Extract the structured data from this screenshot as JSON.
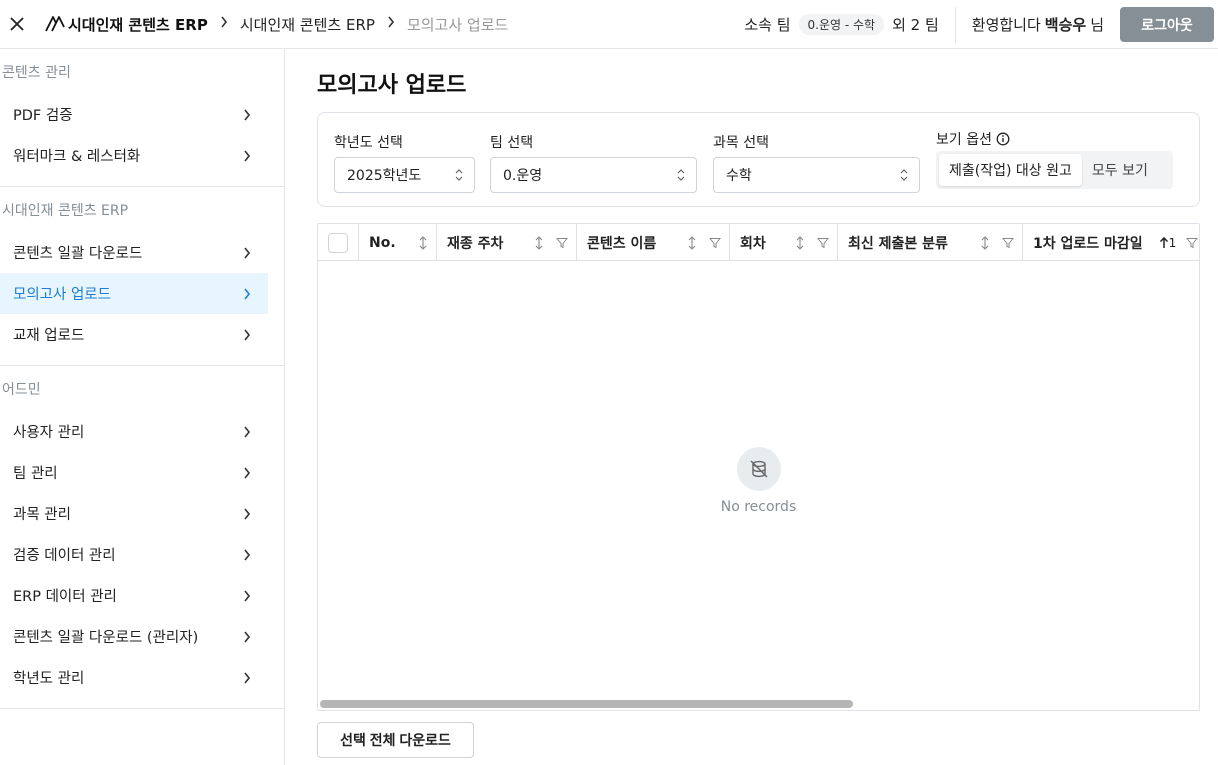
{
  "header": {
    "breadcrumb": {
      "logo_label": "시대인재 콘텐츠 ERP",
      "items": [
        "시대인재 콘텐츠 ERP",
        "모의고사 업로드"
      ]
    },
    "team_label": "소속 팀",
    "team_badge": "0.운영 - 수학",
    "team_extra": "외 2 팀",
    "welcome_prefix": "환영합니다",
    "user_name": "백승우",
    "honorific": "님",
    "logout_label": "로그아웃"
  },
  "sidebar": {
    "sections": [
      {
        "title": "콘텐츠 관리",
        "items": [
          {
            "label": "PDF 검증"
          },
          {
            "label": "워터마크 & 레스터화"
          }
        ]
      },
      {
        "title": "시대인재 콘텐츠 ERP",
        "items": [
          {
            "label": "콘텐츠 일괄 다운로드"
          },
          {
            "label": "모의고사 업로드",
            "active": true
          },
          {
            "label": "교재 업로드"
          }
        ]
      },
      {
        "title": "어드민",
        "items": [
          {
            "label": "사용자 관리"
          },
          {
            "label": "팀 관리"
          },
          {
            "label": "과목 관리"
          },
          {
            "label": "검증 데이터 관리"
          },
          {
            "label": "ERP 데이터 관리"
          },
          {
            "label": "콘텐츠 일괄 다운로드 (관리자)"
          },
          {
            "label": "학년도 관리"
          }
        ]
      }
    ]
  },
  "main": {
    "title": "모의고사 업로드",
    "filters": {
      "year": {
        "label": "학년도 선택",
        "value": "2025학년도"
      },
      "team": {
        "label": "팀 선택",
        "value": "0.운영"
      },
      "subject": {
        "label": "과목 선택",
        "value": "수학"
      },
      "view": {
        "label": "보기 옵션",
        "options": [
          "제출(작업) 대상 원고",
          "모두 보기"
        ],
        "selected": 0
      }
    },
    "table": {
      "columns": [
        "No.",
        "재종 주차",
        "콘텐츠 이름",
        "회차",
        "최신 제출본 분류",
        "1차 업로드 마감일"
      ],
      "sort_indicator": "1",
      "empty_text": "No records"
    },
    "download_label": "선택 전체 다운로드"
  },
  "colors": {
    "active_bg": "#e7f5ff",
    "active_text": "#1c7ed6",
    "logout_bg": "#868e96"
  }
}
